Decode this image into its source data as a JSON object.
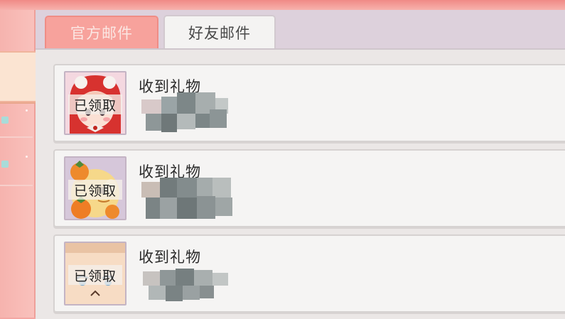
{
  "tabs": [
    {
      "label": "官方邮件",
      "active": false
    },
    {
      "label": "好友邮件",
      "active": true
    }
  ],
  "mails": [
    {
      "title": "收到礼物",
      "status": "已领取",
      "avatar_icon": "red-hood-girl-icon",
      "sender_obscured": true
    },
    {
      "title": "收到礼物",
      "status": "已领取",
      "avatar_icon": "persimmon-character-icon",
      "sender_obscured": true
    },
    {
      "title": "收到礼物",
      "status": "已领取",
      "avatar_icon": "boy-face-icon",
      "sender_obscured": true
    }
  ],
  "colors": {
    "background_pink": "#f3a7a3",
    "tab_inactive": "#f7a29c",
    "tab_active": "#f4f3f2",
    "panel": "#ebe7e6",
    "card": "#f5f4f3"
  }
}
